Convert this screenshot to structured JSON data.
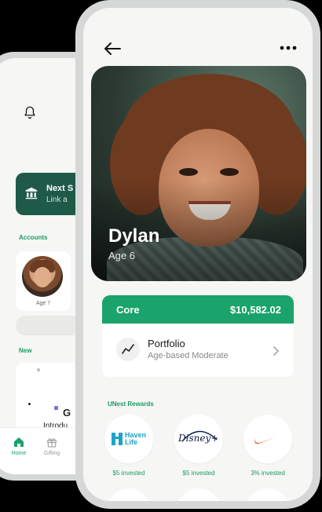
{
  "back_screen": {
    "card": {
      "title": "Next S",
      "subtitle": "Link a"
    },
    "accounts_label": "Accounts",
    "account": {
      "age": "Age 7"
    },
    "new_label": "New",
    "new_card": {
      "text": "Introdu",
      "letter": "G"
    },
    "tabs": [
      {
        "label": "Home",
        "icon": "home-icon"
      },
      {
        "label": "Gifting",
        "icon": "gift-icon"
      }
    ]
  },
  "profile": {
    "name": "Dylan",
    "age": "Age 6"
  },
  "core_account": {
    "label": "Core",
    "balance": "$10,582.02",
    "portfolio_title": "Portfolio",
    "portfolio_subtitle": "Age-based Moderate"
  },
  "rewards": {
    "label": "UNest Rewards",
    "items": [
      {
        "brand": "Haven Life",
        "amount": "$5 invested"
      },
      {
        "brand": "Disney+",
        "amount": "$5 invested"
      },
      {
        "brand": "Nike",
        "amount": "3% invested"
      }
    ]
  },
  "colors": {
    "brand_green": "#1aa36a",
    "dark_green": "#1f5a49",
    "background": "#f6f6f4"
  }
}
